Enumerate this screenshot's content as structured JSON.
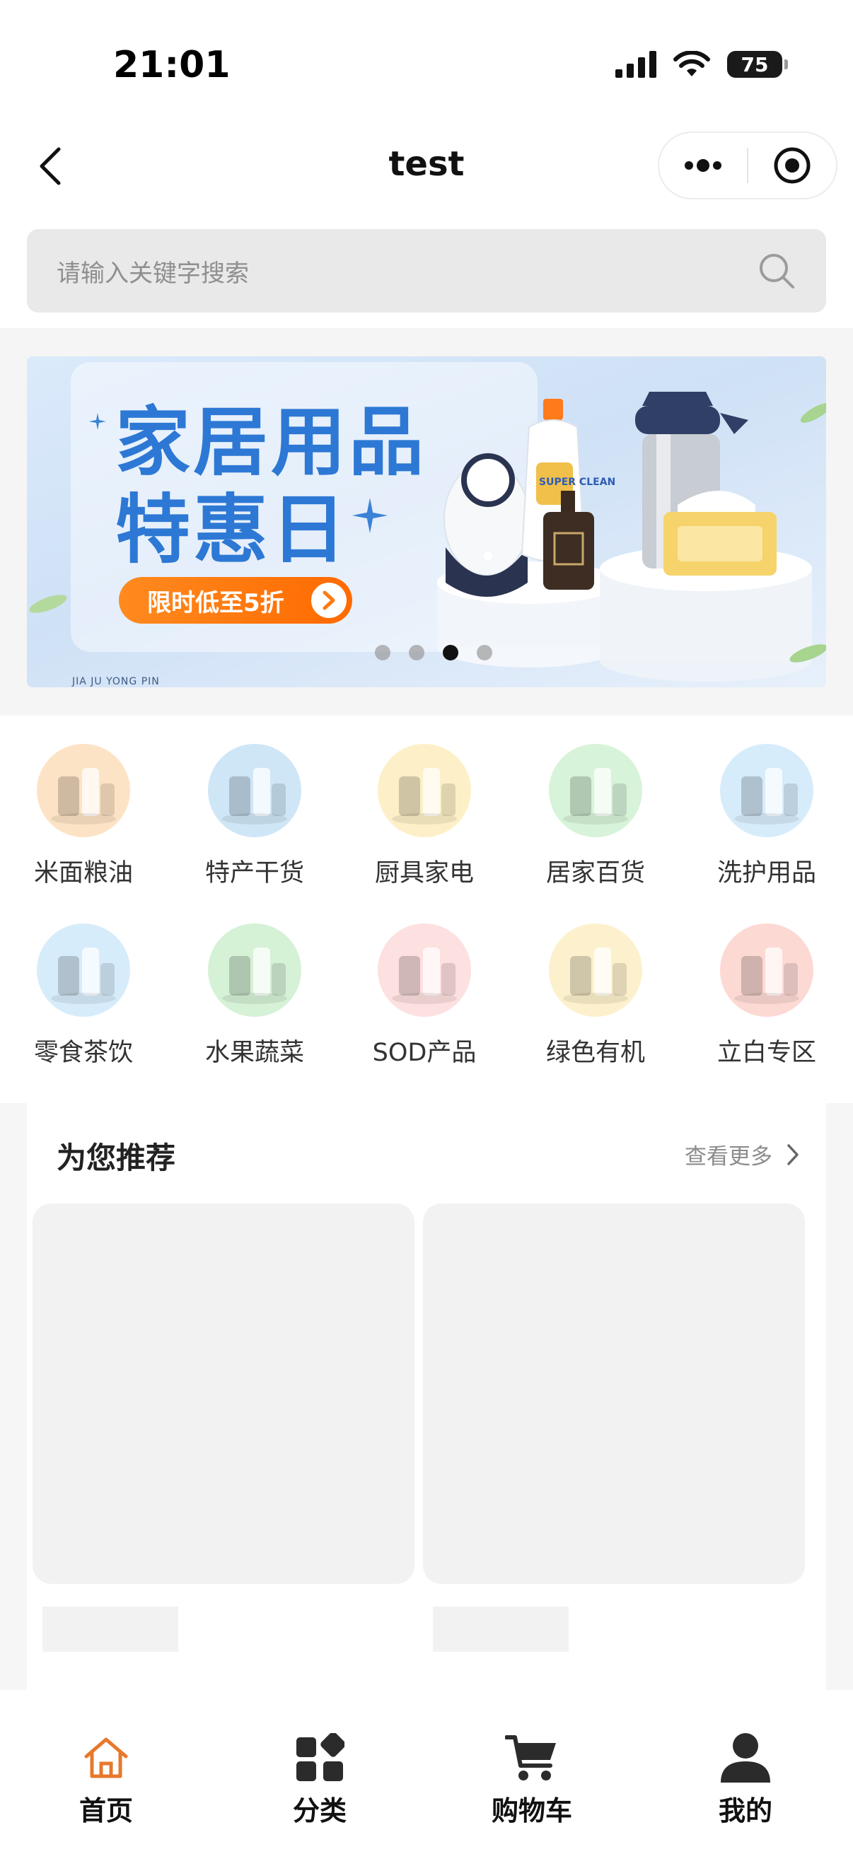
{
  "status_bar": {
    "time": "21:01",
    "battery": "75"
  },
  "nav": {
    "title": "test"
  },
  "search": {
    "placeholder": "请输入关键字搜索"
  },
  "banner": {
    "title_line1": "家居用品",
    "title_line2": "特惠日",
    "promo": "限时低至5折",
    "small_text": "JIA JU YONG PIN",
    "product_label": "SUPER CLEAN",
    "dots": 4,
    "active_dot": 3
  },
  "categories": [
    {
      "label": "米面粮油",
      "icon": "grain-oil-icon",
      "color": "#fde3c5"
    },
    {
      "label": "特产干货",
      "icon": "dried-goods-icon",
      "color": "#cfe6f7"
    },
    {
      "label": "厨具家电",
      "icon": "kitchen-appliance-icon",
      "color": "#fdf0c8"
    },
    {
      "label": "居家百货",
      "icon": "household-icon",
      "color": "#d7f3d9"
    },
    {
      "label": "洗护用品",
      "icon": "toiletries-icon",
      "color": "#d6ecfb"
    },
    {
      "label": "零食茶饮",
      "icon": "snacks-tea-icon",
      "color": "#d7ecfb"
    },
    {
      "label": "水果蔬菜",
      "icon": "fruit-veg-icon",
      "color": "#d5f1d6"
    },
    {
      "label": "SOD产品",
      "icon": "sod-product-icon",
      "color": "#fde0e0"
    },
    {
      "label": "绿色有机",
      "icon": "organic-icon",
      "color": "#fdf1cd"
    },
    {
      "label": "立白专区",
      "icon": "liby-zone-icon",
      "color": "#fdd9d4"
    }
  ],
  "recommend": {
    "title": "为您推荐",
    "more": "查看更多"
  },
  "tabs": [
    {
      "label": "首页",
      "icon": "home-icon",
      "active": true
    },
    {
      "label": "分类",
      "icon": "category-icon",
      "active": false
    },
    {
      "label": "购物车",
      "icon": "cart-icon",
      "active": false
    },
    {
      "label": "我的",
      "icon": "profile-icon",
      "active": false
    }
  ],
  "colors": {
    "accent": "#e8782c",
    "banner_title": "#2d78d4",
    "promo": "#ff7a10",
    "skeleton": "#f2f2f2"
  }
}
